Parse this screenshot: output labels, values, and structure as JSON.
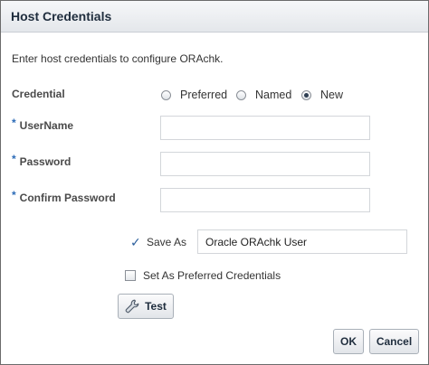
{
  "dialog": {
    "title": "Host Credentials",
    "intro": "Enter host credentials to configure ORAchk."
  },
  "credential": {
    "label": "Credential",
    "options": [
      {
        "label": "Preferred",
        "checked": false
      },
      {
        "label": "Named",
        "checked": false
      },
      {
        "label": "New",
        "checked": true
      }
    ]
  },
  "fields": {
    "required_marker": "*",
    "username": {
      "label": "UserName",
      "value": ""
    },
    "password": {
      "label": "Password",
      "value": ""
    },
    "confirm_password": {
      "label": "Confirm Password",
      "value": ""
    }
  },
  "save_as": {
    "check_glyph": "✓",
    "label": "Save As",
    "value": "Oracle ORAchk User"
  },
  "preferred_checkbox": {
    "label": "Set As Preferred Credentials",
    "checked": false
  },
  "buttons": {
    "test": "Test",
    "ok": "OK",
    "cancel": "Cancel"
  },
  "icons": {
    "test_icon": "wrench-icon"
  },
  "colors": {
    "required_marker": "#2c6bb7",
    "check_mark": "#2a5e9c",
    "title_text": "#1f2d3d"
  }
}
